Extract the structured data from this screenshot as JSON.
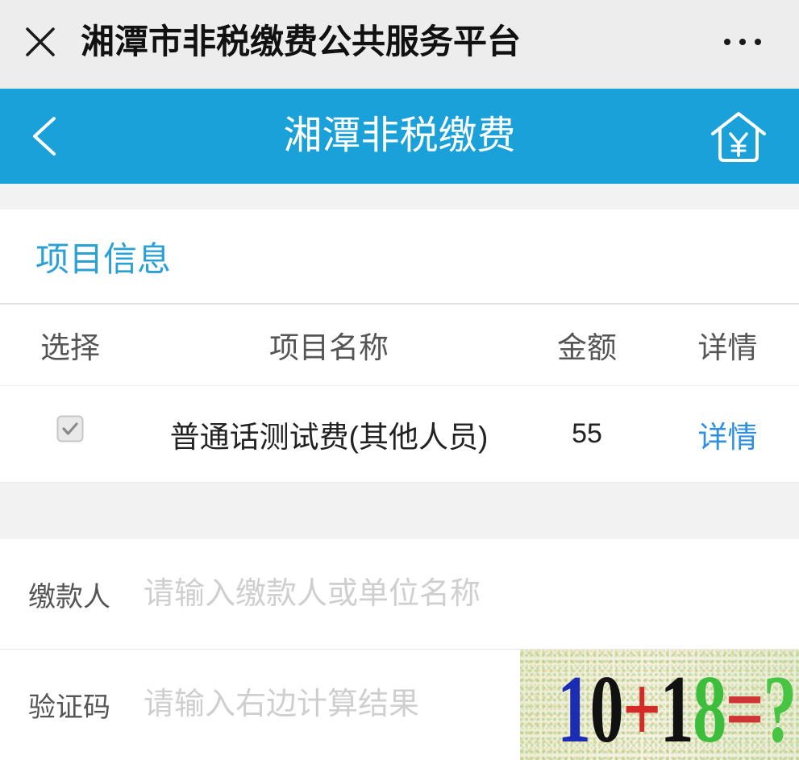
{
  "topbar": {
    "title": "湘潭市非税缴费公共服务平台",
    "close_icon": "close-icon",
    "more_icon": "more-icon"
  },
  "header": {
    "title": "湘潭非税缴费",
    "back_icon": "chevron-left-icon",
    "home_icon": "home-yuan-icon"
  },
  "project_section": {
    "title": "项目信息",
    "columns": [
      "选择",
      "项目名称",
      "金额",
      "详情"
    ],
    "rows": [
      {
        "selected": true,
        "checkbox_icon": "checkmark-icon",
        "name": "普通话测试费(其他人员)",
        "amount": "55",
        "detail_link": "详情"
      }
    ]
  },
  "form": {
    "payer": {
      "label": "缴款人",
      "value": "",
      "placeholder": "请输入缴款人或单位名称"
    },
    "captcha": {
      "label": "验证码",
      "value": "",
      "placeholder": "请输入右边计算结果",
      "image_chars": [
        {
          "char": "1",
          "color": "#1a2db4"
        },
        {
          "char": "0",
          "color": "#111111"
        },
        {
          "char": "+",
          "color": "#d42a2a"
        },
        {
          "char": "1",
          "color": "#111111"
        },
        {
          "char": "8",
          "color": "#3cbd3c"
        },
        {
          "char": "=",
          "color": "#d03535"
        },
        {
          "char": "?",
          "color": "#47c441"
        }
      ]
    }
  },
  "colors": {
    "topbar_bg": "#ededed",
    "header_bg": "#1ba1da",
    "accent": "#2aa0d6",
    "link": "#2f8fe3",
    "page_bg": "#f2f2f2"
  }
}
